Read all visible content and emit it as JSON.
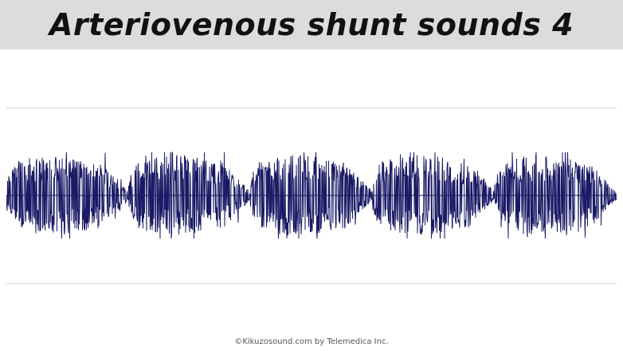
{
  "title": "Arteriovenous shunt sounds 4",
  "copyright": "©Kikuzosound.com by Telemedica Inc.",
  "colors": {
    "title_bar": "#dcdcdc",
    "waveform": "#1a1a66",
    "rule": "#d8d8d8"
  },
  "waveform": {
    "description_type": "audio-waveform",
    "burst_count": 5
  }
}
